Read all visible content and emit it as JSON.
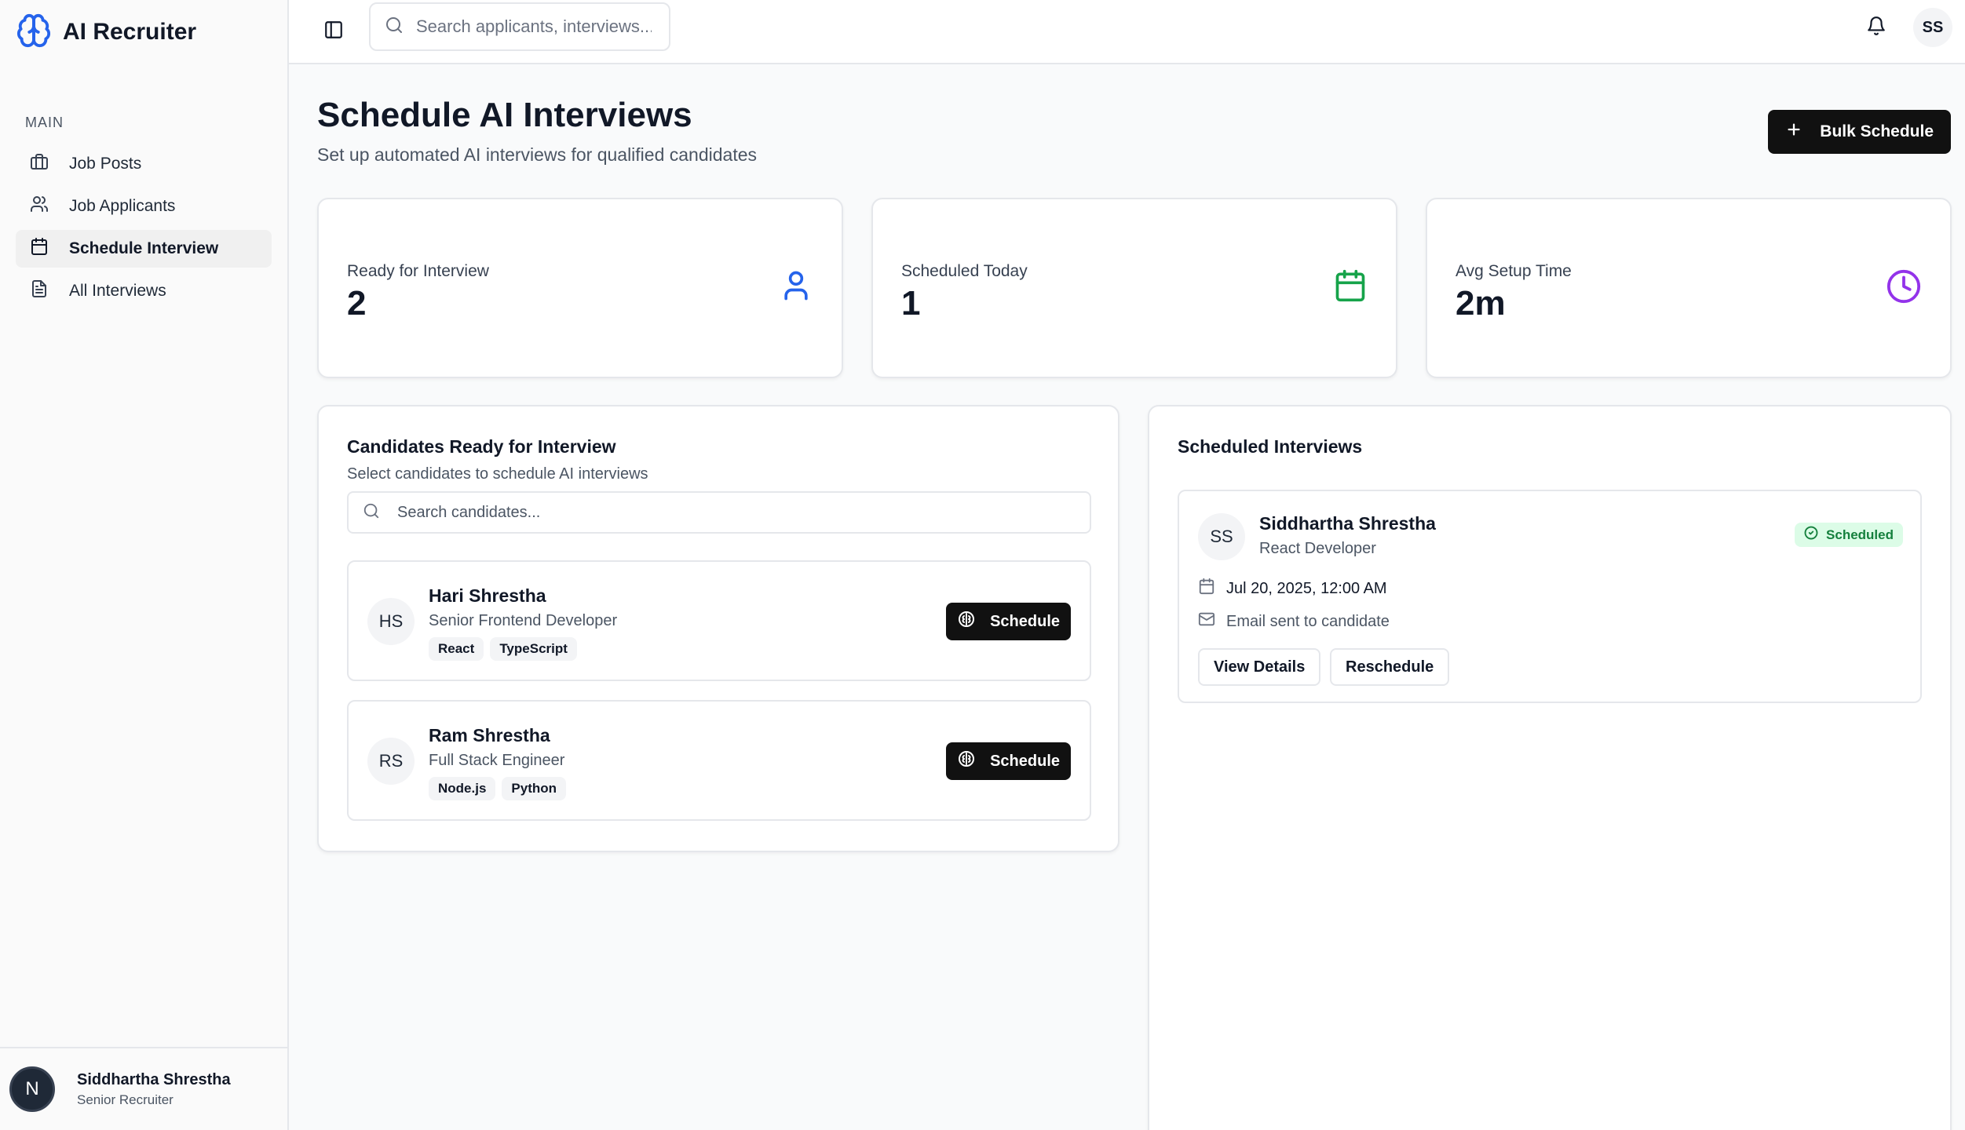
{
  "brand": {
    "name": "AI Recruiter"
  },
  "header": {
    "search_placeholder": "Search applicants, interviews...",
    "user_initials": "SS"
  },
  "sidebar": {
    "section_label": "MAIN",
    "items": [
      {
        "label": "Job Posts",
        "icon": "briefcase-icon"
      },
      {
        "label": "Job Applicants",
        "icon": "users-icon"
      },
      {
        "label": "Schedule Interview",
        "icon": "calendar-icon",
        "active": true
      },
      {
        "label": "All Interviews",
        "icon": "file-text-icon"
      }
    ],
    "footer": {
      "avatar_letter": "N",
      "name": "Siddhartha Shrestha",
      "role": "Senior Recruiter"
    }
  },
  "page": {
    "title": "Schedule AI Interviews",
    "subtitle": "Set up automated AI interviews for qualified candidates",
    "bulk_button": "Bulk Schedule"
  },
  "stats": [
    {
      "label": "Ready for Interview",
      "value": "2",
      "icon": "user-icon",
      "color": "#2563eb"
    },
    {
      "label": "Scheduled Today",
      "value": "1",
      "icon": "calendar-icon",
      "color": "#16a34a"
    },
    {
      "label": "Avg Setup Time",
      "value": "2m",
      "icon": "clock-icon",
      "color": "#9333ea"
    }
  ],
  "candidates_panel": {
    "title": "Candidates Ready for Interview",
    "subtitle": "Select candidates to schedule AI interviews",
    "search_placeholder": "Search candidates...",
    "schedule_label": "Schedule",
    "candidates": [
      {
        "initials": "HS",
        "name": "Hari Shrestha",
        "role": "Senior Frontend Developer",
        "tags": [
          "React",
          "TypeScript"
        ]
      },
      {
        "initials": "RS",
        "name": "Ram Shrestha",
        "role": "Full Stack Engineer",
        "tags": [
          "Node.js",
          "Python"
        ]
      }
    ]
  },
  "scheduled_panel": {
    "title": "Scheduled Interviews",
    "interviews": [
      {
        "initials": "SS",
        "name": "Siddhartha Shrestha",
        "role": "React Developer",
        "status": "Scheduled",
        "datetime": "Jul 20, 2025, 12:00 AM",
        "email_note": "Email sent to candidate",
        "view_label": "View Details",
        "reschedule_label": "Reschedule"
      }
    ]
  },
  "colors": {
    "accent": "#111111",
    "brand": "#2563eb",
    "success": "#16a34a",
    "purple": "#9333ea"
  }
}
